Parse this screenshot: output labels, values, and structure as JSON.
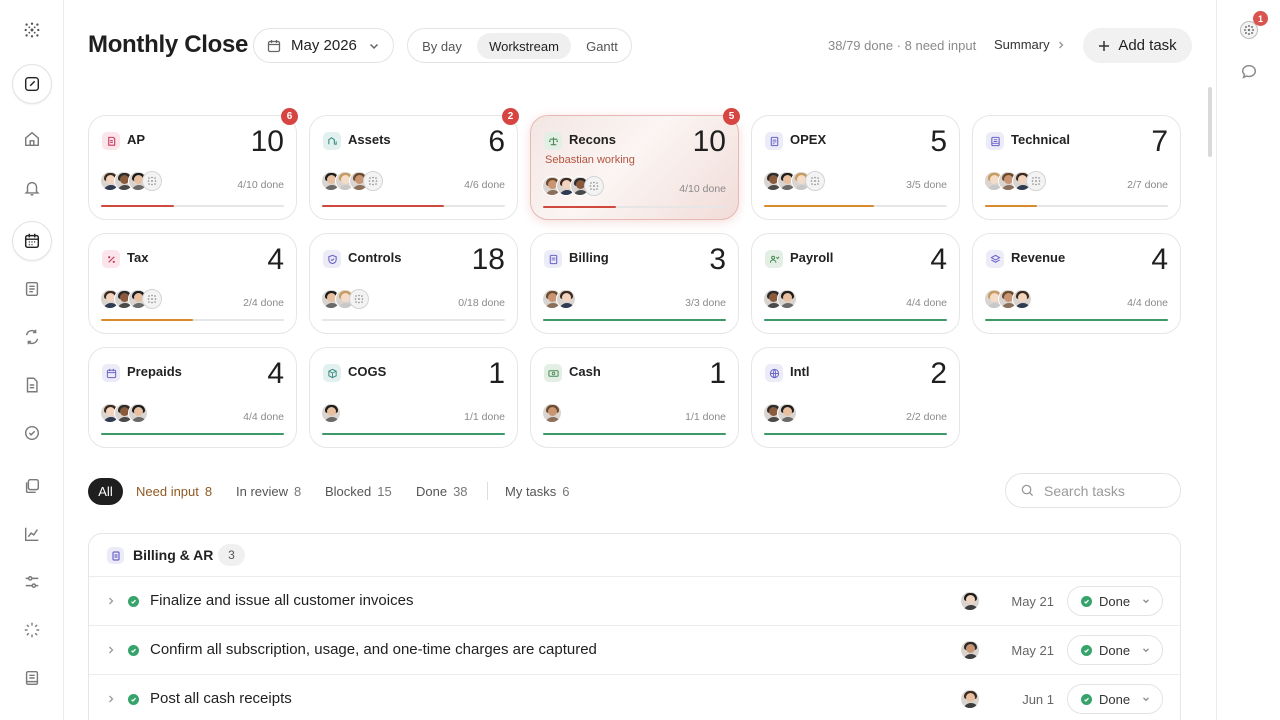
{
  "header": {
    "title": "Monthly Close",
    "period": "May 2026",
    "views": [
      "By day",
      "Workstream",
      "Gantt"
    ],
    "active_view": "Workstream",
    "progress_meta": "38/79 done · 8 need input",
    "summary_label": "Summary",
    "add_task_label": "Add task"
  },
  "notifications": {
    "count": "1"
  },
  "cards": [
    {
      "name": "AP",
      "count": "10",
      "done": "4/10 done",
      "badge": "6",
      "progress": 0.4,
      "bar_color": "#d0493f",
      "icon": "receipt-icon",
      "icon_bg": "#fbe4ea",
      "icon_fg": "#c23a5e",
      "avatars": 3,
      "ghost": true
    },
    {
      "name": "Assets",
      "count": "6",
      "done": "4/6 done",
      "badge": "2",
      "progress": 0.667,
      "bar_color": "#d0493f",
      "icon": "asset-icon",
      "icon_bg": "#e2f1ef",
      "icon_fg": "#3e8f85",
      "avatars": 3,
      "ghost": true
    },
    {
      "name": "Recons",
      "count": "10",
      "done": "4/10 done",
      "badge": "5",
      "progress": 0.4,
      "bar_color": "#d0493f",
      "icon": "scale-icon",
      "icon_bg": "#e3efe4",
      "icon_fg": "#4b8a56",
      "avatars": 3,
      "ghost": true,
      "working": "Sebastian working",
      "highlight": true
    },
    {
      "name": "OPEX",
      "count": "5",
      "done": "3/5 done",
      "progress": 0.6,
      "bar_color": "#d88a2c",
      "icon": "doc-icon",
      "icon_bg": "#ecebf8",
      "icon_fg": "#6c64c8",
      "avatars": 3,
      "ghost": true
    },
    {
      "name": "Technical",
      "count": "7",
      "done": "2/7 done",
      "progress": 0.286,
      "bar_color": "#d88a2c",
      "icon": "ledger-icon",
      "icon_bg": "#ecebf8",
      "icon_fg": "#6c64c8",
      "avatars": 3,
      "ghost": true
    },
    {
      "name": "Tax",
      "count": "4",
      "done": "2/4 done",
      "progress": 0.5,
      "bar_color": "#d88a2c",
      "icon": "percent-icon",
      "icon_bg": "#fbe4ea",
      "icon_fg": "#c23a5e",
      "avatars": 3,
      "ghost": true
    },
    {
      "name": "Controls",
      "count": "18",
      "done": "0/18 done",
      "progress": 0,
      "bar_color": "#d88a2c",
      "icon": "shield-icon",
      "icon_bg": "#ecebf8",
      "icon_fg": "#6c64c8",
      "avatars": 2,
      "ghost": true
    },
    {
      "name": "Billing",
      "count": "3",
      "done": "3/3 done",
      "progress": 1,
      "bar_color": "#3d9a68",
      "icon": "invoice-icon",
      "icon_bg": "#ecebf8",
      "icon_fg": "#6c64c8",
      "avatars": 2,
      "ghost": false
    },
    {
      "name": "Payroll",
      "count": "4",
      "done": "4/4 done",
      "progress": 1,
      "bar_color": "#3d9a68",
      "icon": "people-icon",
      "icon_bg": "#e3efe4",
      "icon_fg": "#4b8a56",
      "avatars": 2,
      "ghost": false
    },
    {
      "name": "Revenue",
      "count": "4",
      "done": "4/4 done",
      "progress": 1,
      "bar_color": "#3d9a68",
      "icon": "layers-icon",
      "icon_bg": "#ecebf8",
      "icon_fg": "#6c64c8",
      "avatars": 3,
      "ghost": false
    },
    {
      "name": "Prepaids",
      "count": "4",
      "done": "4/4 done",
      "progress": 1,
      "bar_color": "#3d9a68",
      "icon": "calendar-icon",
      "icon_bg": "#ecebf8",
      "icon_fg": "#6c64c8",
      "avatars": 3,
      "ghost": false
    },
    {
      "name": "COGS",
      "count": "1",
      "done": "1/1 done",
      "progress": 1,
      "bar_color": "#3d9a68",
      "icon": "box-icon",
      "icon_bg": "#e2f1ef",
      "icon_fg": "#3e8f85",
      "avatars": 1,
      "ghost": false
    },
    {
      "name": "Cash",
      "count": "1",
      "done": "1/1 done",
      "progress": 1,
      "bar_color": "#3d9a68",
      "icon": "cash-icon",
      "icon_bg": "#e3efe4",
      "icon_fg": "#4b8a56",
      "avatars": 1,
      "ghost": false
    },
    {
      "name": "Intl",
      "count": "2",
      "done": "2/2 done",
      "progress": 1,
      "bar_color": "#3d9a68",
      "icon": "globe-icon",
      "icon_bg": "#ecebf8",
      "icon_fg": "#6c64c8",
      "avatars": 2,
      "ghost": false
    }
  ],
  "filters": [
    {
      "label": "All",
      "count": ""
    },
    {
      "label": "Need input",
      "count": "8"
    },
    {
      "label": "In review",
      "count": "8"
    },
    {
      "label": "Blocked",
      "count": "15"
    },
    {
      "label": "Done",
      "count": "38"
    },
    {
      "label": "My tasks",
      "count": "6"
    }
  ],
  "search": {
    "placeholder": "Search tasks"
  },
  "group": {
    "name": "Billing & AR",
    "count": "3",
    "tasks": [
      {
        "title": "Finalize and issue all customer invoices",
        "date": "May 21",
        "status": "Done"
      },
      {
        "title": "Confirm all subscription, usage, and one-time charges are captured",
        "date": "May 21",
        "status": "Done"
      },
      {
        "title": "Post all cash receipts",
        "date": "Jun 1",
        "status": "Done"
      }
    ]
  },
  "colors": {
    "accent_red": "#d0493f",
    "accent_orange": "#d88a2c",
    "accent_green": "#3d9a68",
    "done_green": "#35a36a"
  }
}
